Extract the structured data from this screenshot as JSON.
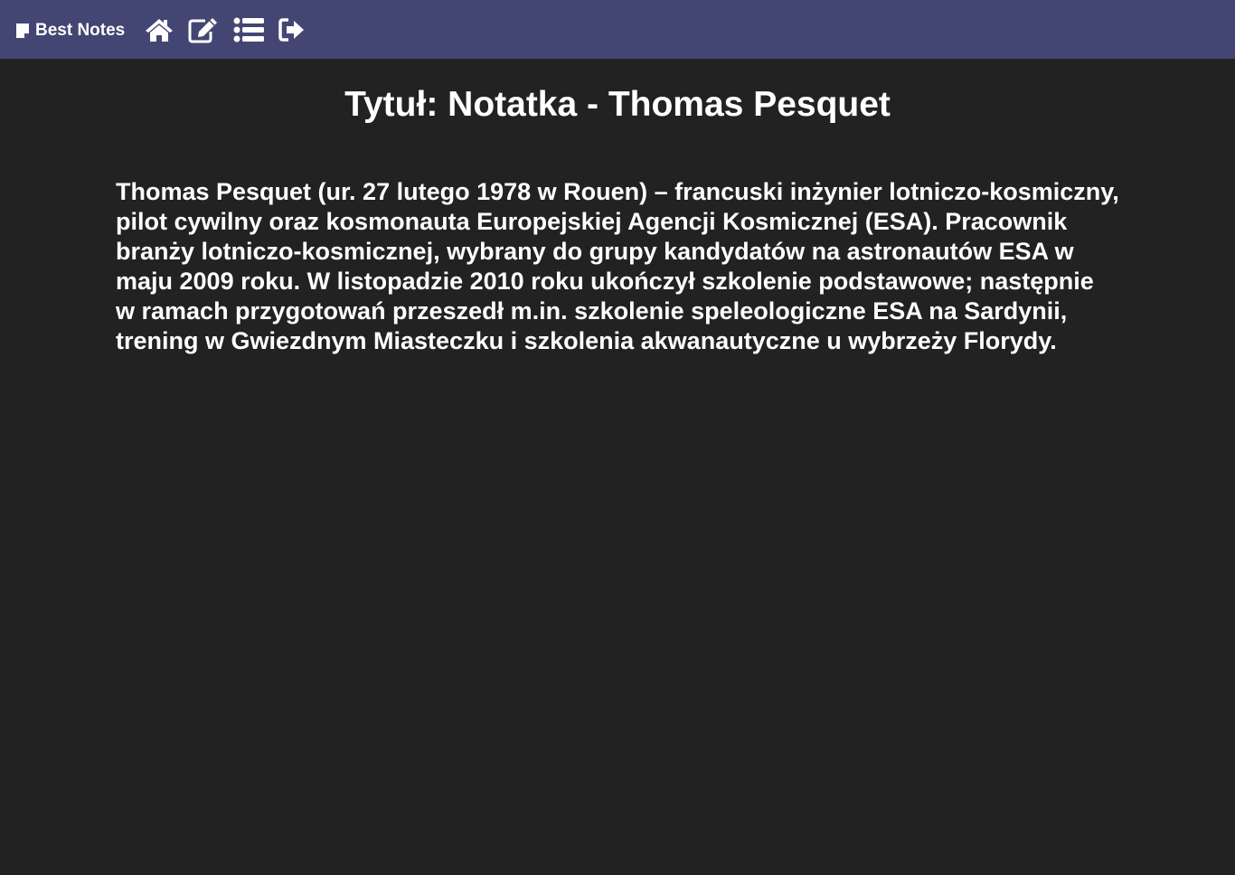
{
  "navbar": {
    "brand_label": "Best Notes",
    "brand_icon": "sticky-note-icon",
    "icons": [
      "home-icon",
      "edit-icon",
      "list-icon",
      "logout-icon"
    ],
    "background": "#434673"
  },
  "note": {
    "title": "Tytuł: Notatka - Thomas Pesquet",
    "body": "Thomas Pesquet (ur. 27 lutego 1978 w Rouen) – francuski inżynier lotniczo-kosmiczny, pilot cywilny oraz kosmonauta Europejskiej Agencji Kosmicznej (ESA). Pracownik branży lotniczo-kosmicznej, wybrany do grupy kandydatów na astronautów ESA w maju 2009 roku. W listopadzie 2010 roku ukończył szkolenie podstawowe; następnie w ramach przygotowań przeszedł m.in. szkolenie speleologiczne ESA na Sardynii, trening w Gwiezdnym Miasteczku i szkolenia akwanautyczne u wybrzeży Florydy."
  },
  "colors": {
    "page_background": "#222222",
    "text": "#ffffff"
  }
}
